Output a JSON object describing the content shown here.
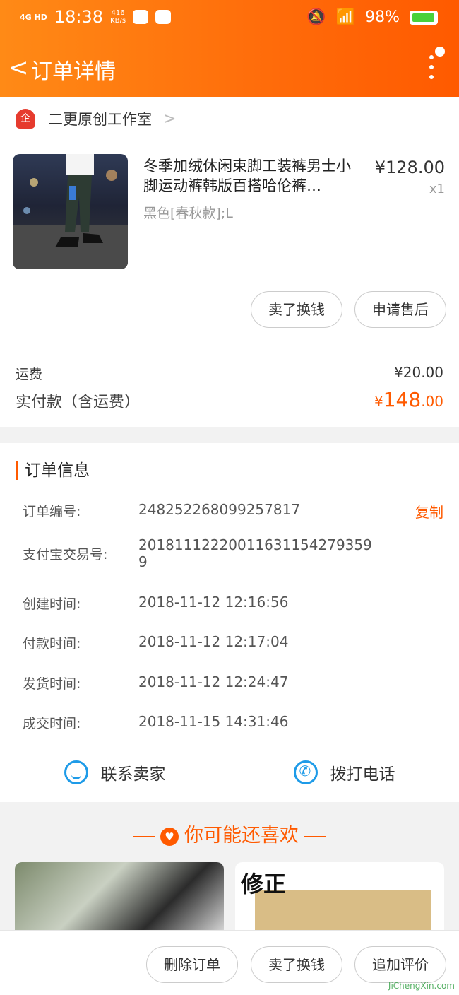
{
  "status_bar": {
    "network": "4G HD",
    "time": "18:38",
    "speed": "416\nKB/s",
    "battery": "98%"
  },
  "nav": {
    "back": "<",
    "title": "订单详情"
  },
  "shop": {
    "badge": "企",
    "name": "二更原创工作室",
    "chevron": ">"
  },
  "product": {
    "title": "冬季加绒休闲束脚工装裤男士小脚运动裤韩版百搭哈伦裤…",
    "spec": "黑色[春秋款];L",
    "price": "¥128.00",
    "qty": "x1"
  },
  "item_actions": [
    "卖了换钱",
    "申请售后"
  ],
  "summary": {
    "shipping_label": "运费",
    "shipping_value": "¥20.00",
    "paid_label": "实付款（含运费）",
    "paid_symbol": "¥",
    "paid_int": "148",
    "paid_dec": ".00"
  },
  "order_info": {
    "title": "订单信息",
    "copy_label": "复制",
    "rows": [
      {
        "label": "订单编号:",
        "value": "248252268099257817"
      },
      {
        "label": "支付宝交易号:",
        "value": "20181112220011631154279359 9"
      },
      {
        "label": "创建时间:",
        "value": "2018-11-12 12:16:56"
      },
      {
        "label": "付款时间:",
        "value": "2018-11-12 12:17:04"
      },
      {
        "label": "发货时间:",
        "value": "2018-11-12 12:24:47"
      },
      {
        "label": "成交时间:",
        "value": "2018-11-15 14:31:46"
      }
    ]
  },
  "contact": {
    "seller": "联系卖家",
    "call": "拨打电话"
  },
  "recommend": {
    "title": "你可能还喜欢",
    "logo_text": "修正"
  },
  "bottom_actions": [
    "删除订单",
    "卖了换钱",
    "追加评价"
  ],
  "watermark": "JiChengXin.com",
  "colors": {
    "accent": "#ff5a00",
    "header_start": "#ff8a16",
    "link_blue": "#1e9be8"
  }
}
